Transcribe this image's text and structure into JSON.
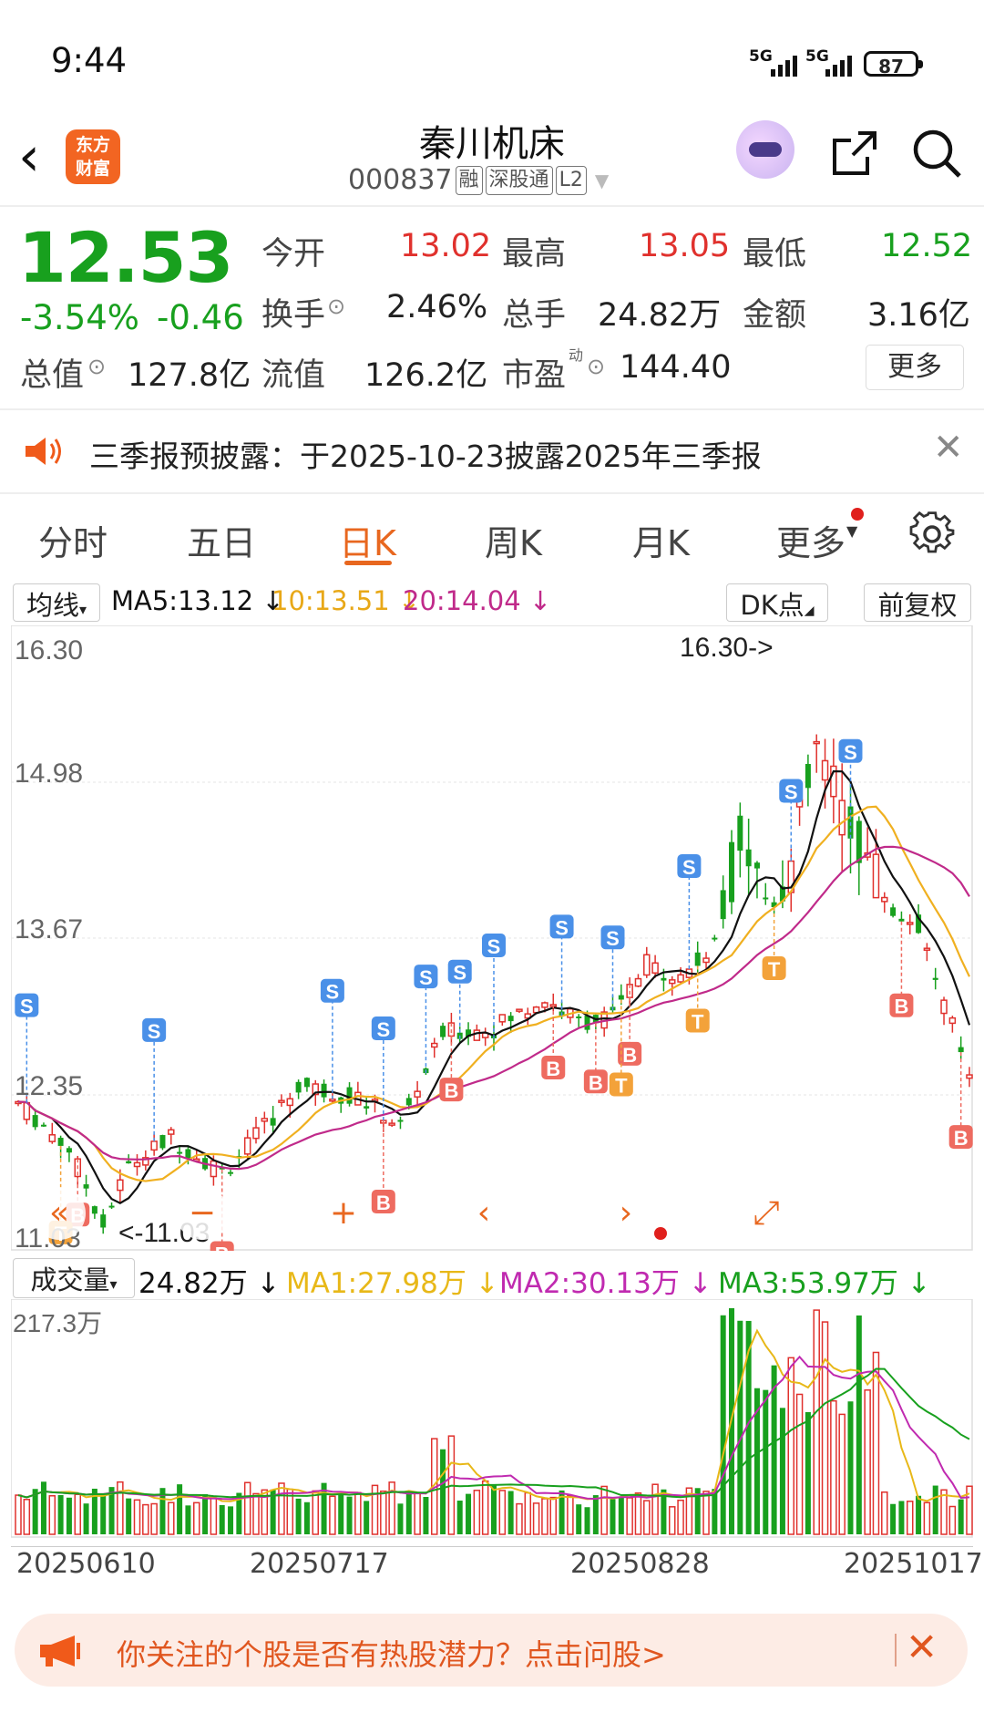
{
  "status_bar": {
    "time": "9:44",
    "signal1": "5G",
    "signal2": "5G",
    "battery": "87"
  },
  "header": {
    "title": "秦川机床",
    "code": "000837",
    "tags": [
      "融",
      "深股通",
      "L2"
    ],
    "logo_text_1": "东方",
    "logo_text_2": "财富"
  },
  "quote": {
    "price": "12.53",
    "change_pct": "-3.54%",
    "change": "-0.46",
    "open_label": "今开",
    "open": "13.02",
    "high_label": "最高",
    "high": "13.05",
    "low_label": "最低",
    "low": "12.52",
    "turnover_label": "换手",
    "turnover": "2.46%",
    "volume_label": "总手",
    "volume": "24.82万",
    "amount_label": "金额",
    "amount": "3.16亿",
    "mcap_label": "总值",
    "mcap": "127.8亿",
    "float_label": "流值",
    "float_cap": "126.2亿",
    "pe_label": "市盈",
    "pe_sup": "动",
    "pe": "144.40",
    "more": "更多"
  },
  "notice": {
    "text": "三季报预披露：于2025-10-23披露2025年三季报"
  },
  "tabs": [
    "分时",
    "五日",
    "日K",
    "周K",
    "月K",
    "更多"
  ],
  "indicators": {
    "ma_select": "均线",
    "ma5": "MA5:13.12 ↓",
    "ma10": "10:13.51 ↓",
    "ma20": "20:14.04 ↓",
    "dk": "DK点",
    "adjust": "前复权"
  },
  "kchart": {
    "y_labels": [
      "16.30",
      "14.98",
      "13.67",
      "12.35",
      "11.03"
    ],
    "high_mark": "16.30->",
    "low_mark": "<-11.03"
  },
  "volume": {
    "select": "成交量",
    "value": "24.82万 ↓",
    "ma1": "MA1:27.98万 ↓",
    "ma2": "MA2:30.13万 ↓",
    "ma3": "MA3:53.97万 ↓",
    "max_label": "217.3万"
  },
  "dates": [
    "20250610",
    "20250717",
    "20250828",
    "20251017"
  ],
  "controls": [
    "«",
    "−",
    "+",
    "‹",
    "›",
    "⤢"
  ],
  "banner": {
    "text": "你关注的个股是否有热股潜力？点击问股>"
  },
  "colors": {
    "up": "#e0312d",
    "down": "#18a01e",
    "accent": "#e8671f",
    "ma5": "#111111",
    "ma10": "#f0b020",
    "ma20": "#c02a8a"
  }
}
